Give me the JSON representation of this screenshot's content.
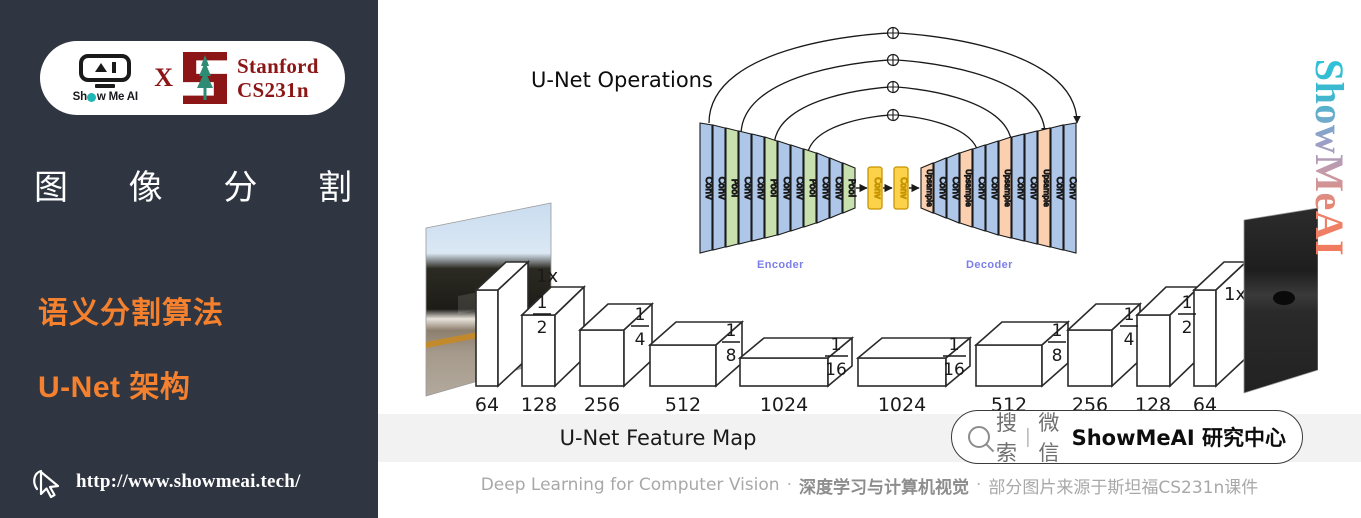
{
  "sidebar": {
    "logo": {
      "smai_word_pre": "Sh",
      "smai_word_post": "w Me AI",
      "smai_icon": "showmeai-robot-icon",
      "x_label": "X",
      "stanford_line1": "Stanford",
      "stanford_line2": "CS231n",
      "stanford_icon": "stanford-tree-logo"
    },
    "section_title_chars": [
      "图",
      "像",
      "分",
      "割"
    ],
    "subtitle_1": "语义分割算法",
    "subtitle_2": "U-Net 架构",
    "url": "http://www.showmeai.tech/",
    "cursor_icon": "mouse-pointer-icon",
    "accent_color": "#f5802d",
    "background_color": "#2f3641"
  },
  "content": {
    "ops_title": "U-Net Operations",
    "encoder_label": "Encoder",
    "decoder_label": "Decoder",
    "caption": "U-Net Feature Map",
    "vertical_brand": "ShowMeAI",
    "search_widget": {
      "icon": "search-icon",
      "search_label": "搜索",
      "separator": "|",
      "channel_label": "微信",
      "brand_label": "ShowMeAI 研究中心"
    },
    "footer": {
      "english": "Deep Learning for Computer Vision",
      "dot1": "·",
      "chinese_bold": "深度学习与计算机视觉",
      "dot2": "·",
      "chinese_note": "部分图片来源于斯坦福CS231n课件"
    },
    "colors": {
      "conv_blue": "#aec6e8",
      "pool_green": "#c7e0ae",
      "bottleneck_yellow": "#fcd24a",
      "upsample_peach": "#fad0b0",
      "label_purple": "#7b7fe8",
      "caption_band": "#f2f2f2"
    }
  },
  "chart_data": {
    "type": "diagram",
    "title": "U-Net Operations",
    "ops_sequence": {
      "encoder": [
        "Conv",
        "Conv",
        "Pool",
        "Conv",
        "Conv",
        "Pool",
        "Conv",
        "Conv",
        "Pool",
        "Conv",
        "Conv",
        "Pool"
      ],
      "bottleneck": [
        "Conv",
        "Conv"
      ],
      "decoder": [
        "Upsample",
        "Conv",
        "Conv",
        "Upsample",
        "Conv",
        "Conv",
        "Upsample",
        "Conv",
        "Conv",
        "Upsample",
        "Conv",
        "Conv"
      ]
    },
    "skip_connections": 4,
    "skip_merge_symbol": "⊕",
    "feature_map": {
      "caption": "U-Net Feature Map",
      "channels": [
        64,
        128,
        256,
        512,
        1024,
        1024,
        512,
        256,
        128,
        64
      ],
      "scales": [
        "1x",
        "1/2",
        "1/4",
        "1/8",
        "1/16",
        "1/16",
        "1/8",
        "1/4",
        "1/2",
        "1x"
      ],
      "input_label": "1x",
      "output_label": "1x",
      "input_image": "road-scene-photo",
      "output_image": "segmentation-mask"
    }
  }
}
